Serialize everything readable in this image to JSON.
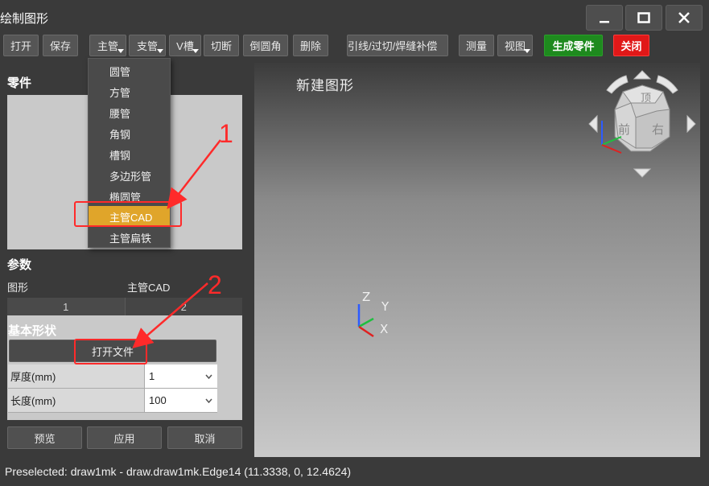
{
  "window": {
    "title": "绘制图形"
  },
  "toolbar": {
    "open": "打开",
    "save": "保存",
    "main_pipe": "主管",
    "branch_pipe": "支管",
    "v_groove": "V槽",
    "cut": "切断",
    "fillet": "倒圆角",
    "delete": "删除",
    "weld": "引线/过切/焊缝补偿",
    "measure": "测量",
    "view": "视图",
    "generate": "生成零件",
    "close": "关闭"
  },
  "dropdown": {
    "items": [
      "圆管",
      "方管",
      "腰管",
      "角钢",
      "槽钢",
      "多边形管",
      "椭圆管",
      "主管CAD",
      "主管扁铁"
    ],
    "highlighted": "主管CAD"
  },
  "left_panel": {
    "parts_title": "零件",
    "params_title": "参数",
    "shape_label": "图形",
    "shape_value": "主管CAD",
    "tabs": [
      "1",
      "2"
    ],
    "basic_shape": "基本形状",
    "open_file": "打开文件",
    "thickness_label": "厚度(mm)",
    "thickness_value": "1",
    "length_label": "长度(mm)",
    "length_value": "100",
    "preview": "预览",
    "apply": "应用",
    "cancel": "取消"
  },
  "viewport": {
    "title": "新建图形",
    "axis_z": "Z",
    "axis_y": "Y",
    "axis_x": "X",
    "cube_top": "顶",
    "cube_front": "前",
    "cube_right": "右"
  },
  "annotations": {
    "one": "1",
    "two": "2"
  },
  "status": {
    "text": "Preselected: draw1mk - draw.draw1mk.Edge14 (11.3338, 0, 12.4624)"
  },
  "colors": {
    "background": "#3a3a3a",
    "button_green": "#1e8a1e",
    "button_red": "#e01818",
    "highlight": "#e0a52a",
    "callout": "#ff2a2a"
  }
}
